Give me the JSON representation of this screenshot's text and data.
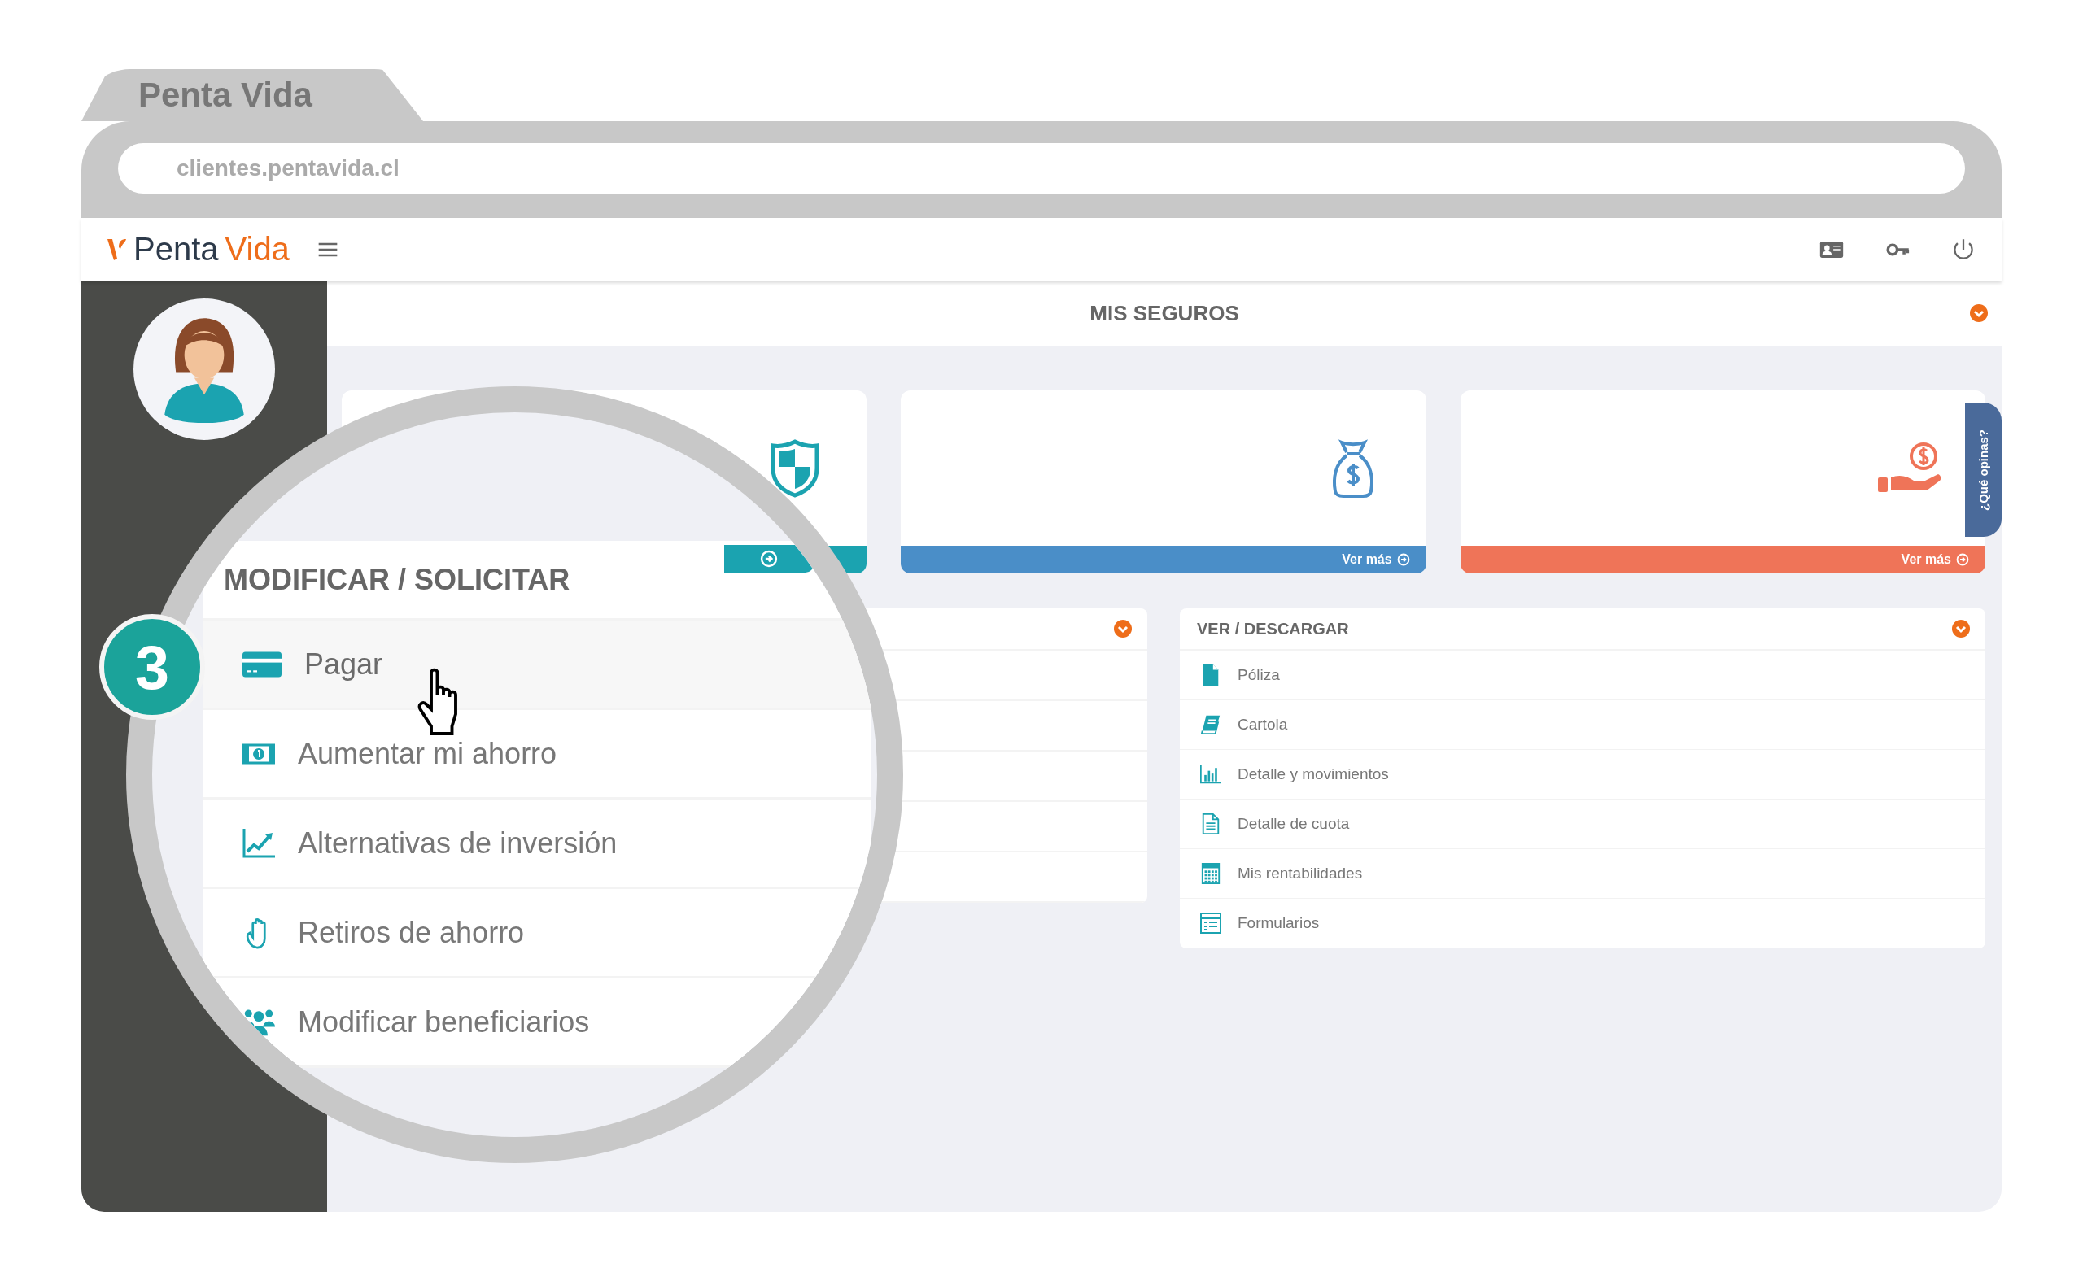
{
  "browser": {
    "tab_title": "Penta Vida",
    "url": "clientes.pentavida.cl"
  },
  "header": {
    "logo_word_1": "Penta",
    "logo_word_2": "Vida"
  },
  "section_title": "MIS SEGUROS",
  "cards": [
    {
      "kind": "shield",
      "color": "#1ba3b0"
    },
    {
      "kind": "money-bag",
      "color": "#4a8ec8",
      "link": "Ver más"
    },
    {
      "kind": "hand-coin",
      "color": "#ef7458",
      "link": "Ver más"
    }
  ],
  "feedback_tab": "¿Qué opinas?",
  "modify_panel": {
    "title": "MODIFICAR / SOLICITAR",
    "step": "3",
    "items": [
      {
        "label": "Pagar",
        "kind": "card",
        "selected": true
      },
      {
        "label": "Aumentar mi ahorro",
        "kind": "bill",
        "selected": false
      },
      {
        "label": "Alternativas de inversión",
        "kind": "chart",
        "selected": false
      },
      {
        "label": "Retiros de ahorro",
        "kind": "hand",
        "selected": false
      },
      {
        "label": "Modificar beneficiarios",
        "kind": "people",
        "selected": false
      }
    ]
  },
  "download_panel": {
    "title": "VER / DESCARGAR",
    "items": [
      {
        "label": "Póliza",
        "kind": "file"
      },
      {
        "label": "Cartola",
        "kind": "book"
      },
      {
        "label": "Detalle y movimientos",
        "kind": "bars"
      },
      {
        "label": "Detalle de cuota",
        "kind": "doc"
      },
      {
        "label": "Mis rentabilidades",
        "kind": "calc"
      },
      {
        "label": "Formularios",
        "kind": "form"
      }
    ]
  }
}
